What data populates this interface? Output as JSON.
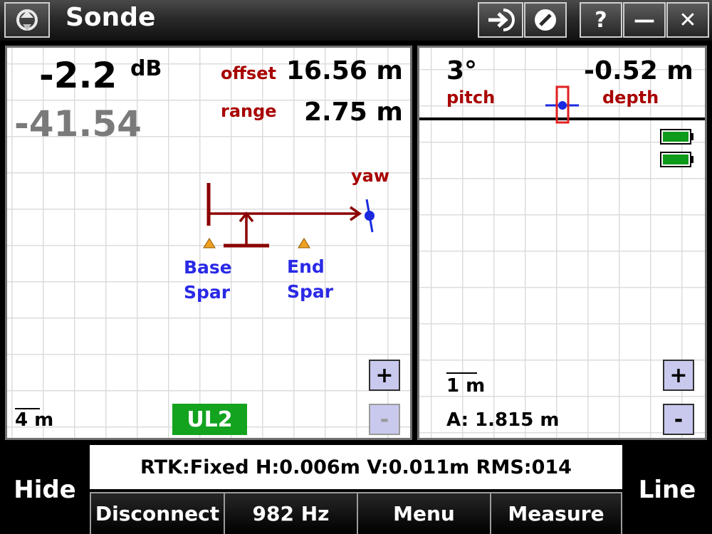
{
  "window": {
    "title": "Sonde",
    "help_label": "?",
    "minimize_label": "—",
    "close_label": "✕"
  },
  "left_panel": {
    "signal_db": "-2.2",
    "db_unit": "dB",
    "signal_raw": "-41.54",
    "offset_label": "offset",
    "offset_value": "16.56 m",
    "range_label": "range",
    "range_value": "2.75 m",
    "yaw_label": "yaw",
    "base_spar_line1": "Base",
    "base_spar_line2": "Spar",
    "end_spar_line1": "End",
    "end_spar_line2": "Spar",
    "scale_label": "4 m",
    "mode_badge": "UL2",
    "zoom_in_label": "+",
    "zoom_out_label": "-"
  },
  "right_panel": {
    "pitch_value": "3°",
    "pitch_label": "pitch",
    "depth_value": "-0.52 m",
    "depth_label": "depth",
    "scale_label": "1 m",
    "antenna_label": "A: 1.815 m",
    "zoom_in_label": "+",
    "zoom_out_label": "-",
    "battery_color": "#0e9a1a"
  },
  "status_bar": {
    "text": "RTK:Fixed H:0.006m V:0.011m RMS:014"
  },
  "softkeys": {
    "hide": "Hide",
    "line": "Line",
    "disconnect": "Disconnect",
    "frequency": "982 Hz",
    "menu": "Menu",
    "measure": "Measure"
  },
  "colors": {
    "accent_red": "#a80000",
    "label_blue": "#2a2ae6",
    "sonde_blue": "#1a2ae0",
    "spar_orange": "#f0a020",
    "badge_green": "#13a31f"
  }
}
